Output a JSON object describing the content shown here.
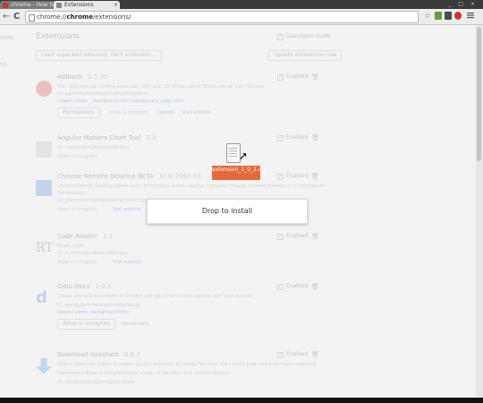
{
  "tabs": [
    {
      "title": "chrome - How to",
      "close": "×"
    },
    {
      "title": "Extensions",
      "close": "×"
    }
  ],
  "window_controls": "_ □ ×",
  "toolbar": {
    "back": "←",
    "forward": "→",
    "reload": "C",
    "url_scheme": "chrome://",
    "url_host": "chrome",
    "url_path": "/extensions/",
    "star": "☆"
  },
  "sidebar": {
    "items": [
      "ome",
      "ns"
    ]
  },
  "page": {
    "heading": "Extensions",
    "developer_mode": "Developer mode",
    "load_unpacked": "Load unpacked extension...",
    "pack": "Pack extension...",
    "update": "Update extensions now"
  },
  "extensions": [
    {
      "name": "AdBlock",
      "version": "2.5.30",
      "lines": [
        "The most popular Chrome extension, with over 15 million users! Blocks ads all over the web.",
        "ID: gighmmpiobklfepjocnamgkkbiglidom",
        "Inspect views: _background.html  background_page.html"
      ],
      "links": [
        "Permissions",
        "Allow in incognito",
        "Options",
        "Visit website"
      ],
      "enabled": "Enabled",
      "icon_color": "#d33"
    },
    {
      "name": "Angular Matters Chart Tool",
      "version": "1.0",
      "lines": [
        "ID: ccaelmbpmijjhjaooecjbkdfoo"
      ],
      "links": [
        "Allow in incognito"
      ],
      "enabled": "Enabled",
      "icon_color": "#aaa"
    },
    {
      "name": "Chrome Remote Desktop BETA",
      "version": "37.0.2062.50",
      "lines": [
        "Chrome Remote Desktop allows users to remotely access another computer through Chrome browser or a Chromebook.",
        "Permissions",
        "ID: gbchcmhmhahfdphkhkmpfmihenigjmpp"
      ],
      "links": [
        "Allow in incognito",
        "Visit website"
      ],
      "enabled": "Enabled",
      "icon_color": "#3a7bd5"
    },
    {
      "name": "Code Reader",
      "version": "1.1",
      "lines": [
        "Reads code",
        "ID: mcifiliceblokdkeaokffdmgao"
      ],
      "links": [
        "Allow in incognito",
        "Visit website"
      ],
      "enabled": "Enabled",
      "icon_color": "#888"
    },
    {
      "name": "Ditto Docs",
      "version": "1.0.5",
      "lines": [
        "Create and edit documents in Chrome and sync them across devices with your account.",
        "ID: ekckgcjkoiliokdfmgdmobbkhkepg",
        "Inspect views: background.html"
      ],
      "links": [
        "Allow in incognito",
        "Permissions"
      ],
      "enabled": "Enabled",
      "icon_color": "#3a7bd5"
    },
    {
      "name": "Download Assistant",
      "version": "0.6.7",
      "lines": [
        "Adds a download button to pages, quickly download all media files from the current page and keep them organized.",
        "Permissions  Allow in incognito  Allow access to file URLs  Visit website  Options",
        "ID: ahkfbhkpbkifajpnbigjbdfcdjikoe"
      ],
      "links": [],
      "enabled": "Enabled",
      "icon_color": "#3a8fe0"
    }
  ],
  "drag": {
    "label": "extension_1_0_2.crx"
  },
  "drop": {
    "text": "Drop to install"
  },
  "colors": {
    "accent": "#e5693a",
    "link": "#1155cc",
    "tab_bar": "#3a3a3a"
  }
}
